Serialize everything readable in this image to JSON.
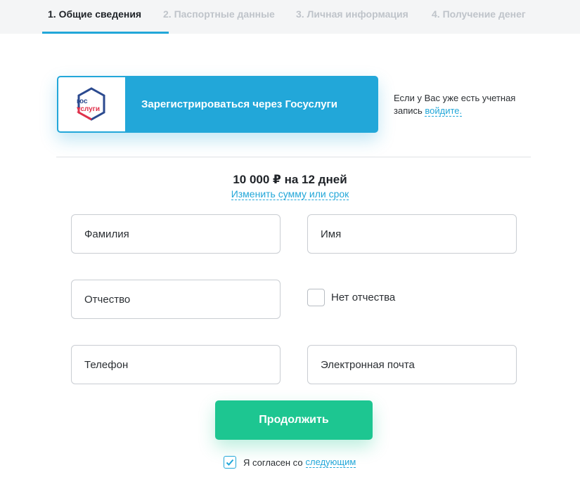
{
  "steps": [
    {
      "label": "1. Общие сведения"
    },
    {
      "label": "2. Паспортные данные"
    },
    {
      "label": "3. Личная информация"
    },
    {
      "label": "4. Получение денег"
    }
  ],
  "gosuslugi": {
    "logo_top": "гос",
    "logo_bottom": "услуги",
    "button_label": "Зарегистрироваться через Госуслуги"
  },
  "login_note": {
    "text_line": "Если у Вас уже есть учетная запись",
    "link": "войдите."
  },
  "summary": {
    "amount_text": "10 000 ₽ на 12 дней",
    "change_link": "Изменить сумму или срок"
  },
  "form": {
    "last_name_placeholder": "Фамилия",
    "first_name_placeholder": "Имя",
    "middle_name_placeholder": "Отчество",
    "no_middle_name_label": "Нет отчества",
    "phone_placeholder": "Телефон",
    "email_placeholder": "Электронная почта"
  },
  "continue_label": "Продолжить",
  "agree": {
    "text": "Я согласен со",
    "link": "следующим",
    "checked": true
  },
  "colors": {
    "accent_blue": "#22a7d9",
    "accent_green": "#1dc691",
    "gos_red": "#e0314b",
    "gos_navy": "#2b4a8f"
  }
}
